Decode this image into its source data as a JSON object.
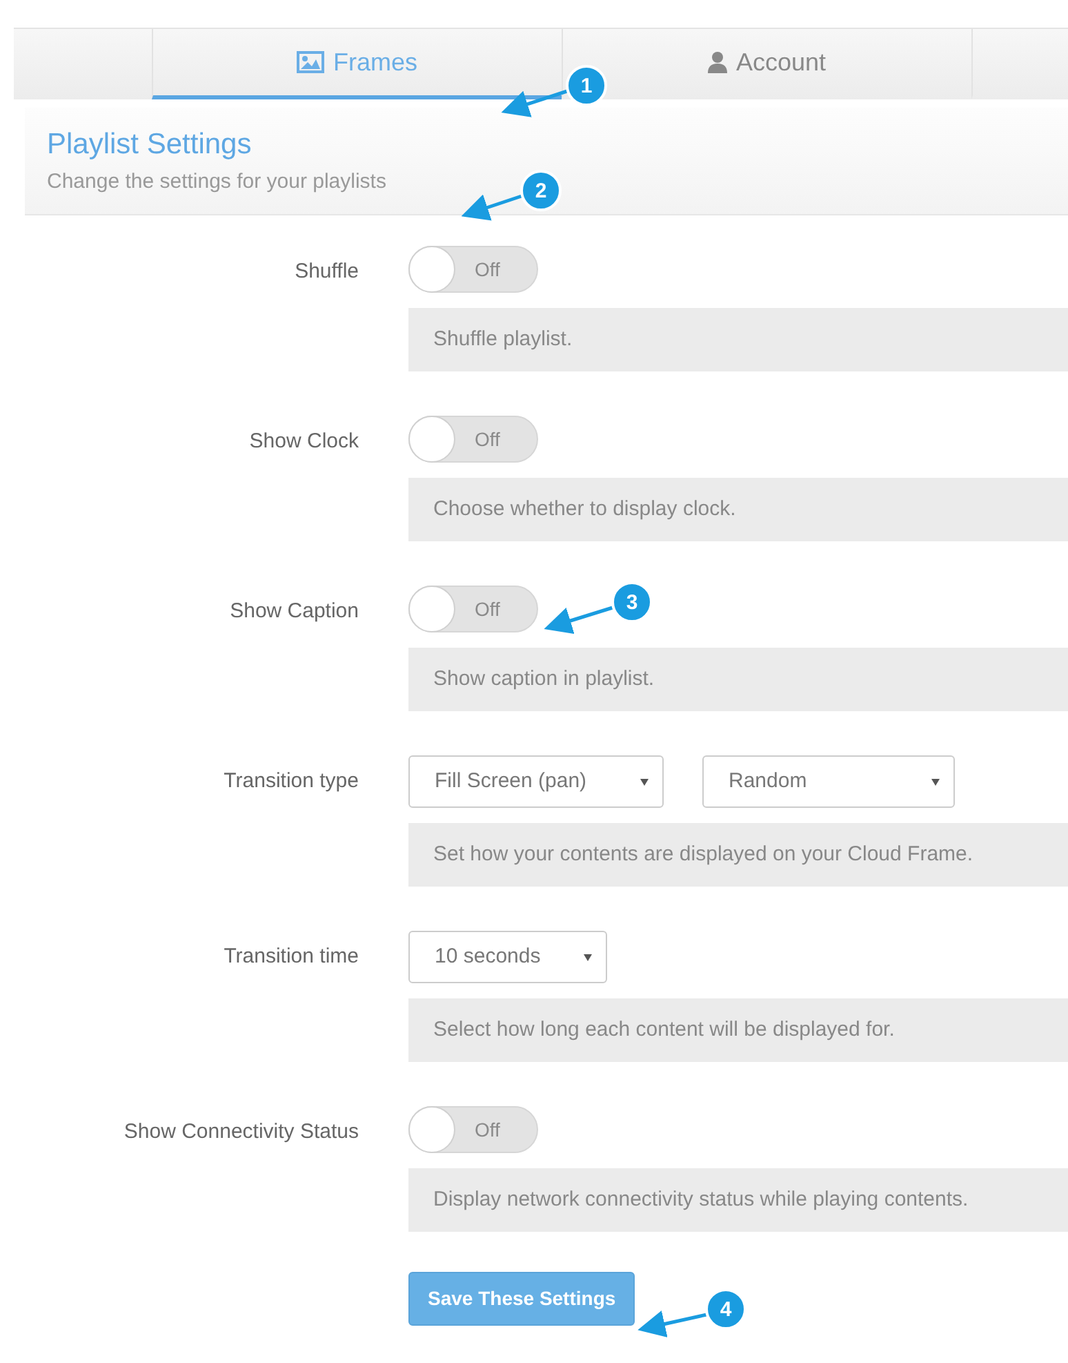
{
  "tabs": [
    {
      "label": "Frames",
      "selected": true
    },
    {
      "label": "Account",
      "selected": false
    }
  ],
  "panel": {
    "title": "Playlist Settings",
    "subtitle": "Change the settings for your playlists"
  },
  "settings": [
    {
      "kind": "toggle",
      "label": "Shuffle",
      "on": false,
      "state_label": "Off",
      "help": "Shuffle playlist."
    },
    {
      "kind": "toggle",
      "label": "Show Clock",
      "on": false,
      "state_label": "Off",
      "help": "Choose whether to display clock."
    },
    {
      "kind": "toggle",
      "label": "Show Caption",
      "on": false,
      "state_label": "Off",
      "help": "Show caption in playlist."
    },
    {
      "kind": "select",
      "label": "Transition type",
      "values": [
        "Fill Screen (pan)",
        "Random"
      ],
      "help": "Set how your contents are displayed on your Cloud Frame."
    },
    {
      "kind": "select",
      "label": "Transition time",
      "values": [
        "10 seconds"
      ],
      "help": "Select how long each content will be displayed for."
    },
    {
      "kind": "toggle",
      "label": "Show Connectivity Status",
      "on": false,
      "state_label": "Off",
      "help": "Display network connectivity status while playing contents."
    }
  ],
  "save_button": "Save These Settings",
  "callouts": [
    "1",
    "2",
    "3",
    "4"
  ]
}
